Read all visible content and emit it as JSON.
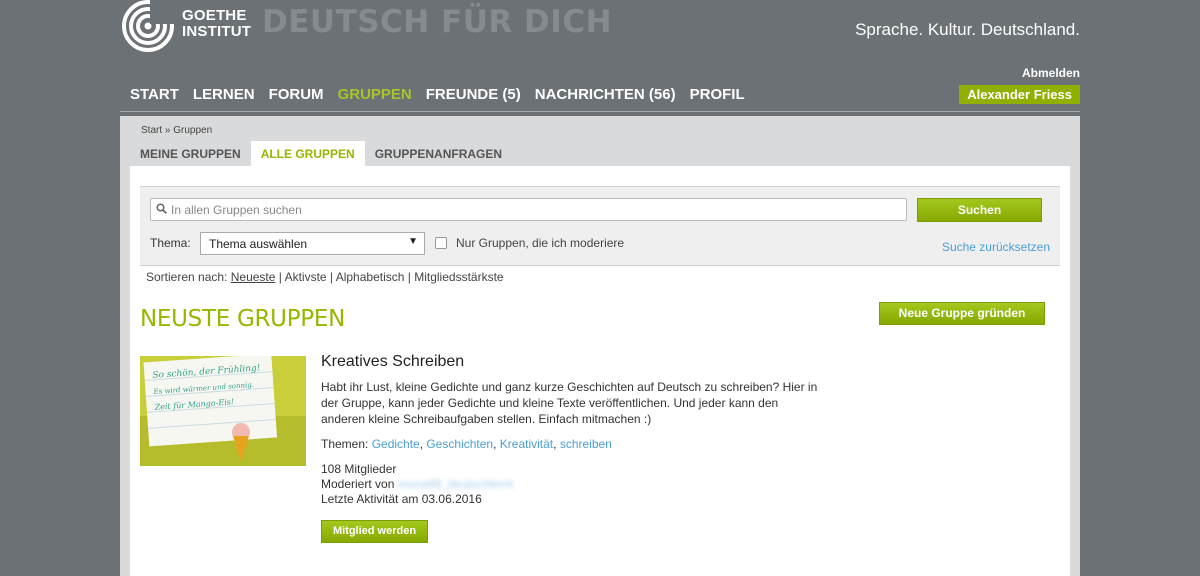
{
  "header": {
    "logo_line1": "GOETHE",
    "logo_line2": "INSTITUT",
    "site_title": "DEUTSCH FÜR DICH",
    "slogan": "Sprache. Kultur. Deutschland.",
    "logout": "Abmelden",
    "user_name": "Alexander Friess"
  },
  "nav": {
    "items": [
      {
        "label": "START",
        "active": false
      },
      {
        "label": "LERNEN",
        "active": false
      },
      {
        "label": "FORUM",
        "active": false
      },
      {
        "label": "GRUPPEN",
        "active": true
      },
      {
        "label": "FREUNDE (5)",
        "active": false
      },
      {
        "label": "NACHRICHTEN (56)",
        "active": false
      },
      {
        "label": "PROFIL",
        "active": false
      }
    ]
  },
  "breadcrumb": "Start » Gruppen",
  "tabs": [
    {
      "label": "MEINE GRUPPEN",
      "active": false
    },
    {
      "label": "ALLE GRUPPEN",
      "active": true
    },
    {
      "label": "GRUPPENANFRAGEN",
      "active": false
    }
  ],
  "search": {
    "placeholder": "In allen Gruppen suchen",
    "button": "Suchen",
    "theme_label": "Thema:",
    "theme_select": "Thema auswählen",
    "moderate_label": "Nur Gruppen, die ich moderiere",
    "reset": "Suche zurücksetzen"
  },
  "sort": {
    "label": "Sortieren nach:",
    "options": [
      "Neueste",
      "Aktivste",
      "Alphabetisch",
      "Mitgliedsstärkste"
    ],
    "active": "Neueste"
  },
  "section": {
    "title": "NEUSTE GRUPPEN",
    "new_group_button": "Neue Gruppe gründen"
  },
  "group": {
    "name": "Kreatives Schreiben",
    "description": "Habt ihr Lust, kleine Gedichte und ganz kurze Geschichten auf Deutsch zu schreiben? Hier in der Gruppe, kann jeder Gedichte und kleine Texte veröffentlichen. Und jeder kann den anderen kleine Schreibaufgaben stellen. Einfach mitmachen :)",
    "topics_label": "Themen:",
    "topics": [
      "Gedichte",
      "Geschichten",
      "Kreativität",
      "schreiben"
    ],
    "members": "108 Mitglieder",
    "moderated_by_label": "Moderiert von",
    "moderator": "mona99_deutschlernt",
    "last_activity": "Letzte Aktivität am 03.06.2016",
    "join_button": "Mitglied werden",
    "thumbnail_text": [
      "So schön, der Frühling!",
      "Es wird wärmer und sonnig.",
      "Zeit für Mango-Eis!"
    ]
  },
  "colors": {
    "accent": "#94b800",
    "link": "#4a9fd5",
    "background": "#6b7174"
  }
}
